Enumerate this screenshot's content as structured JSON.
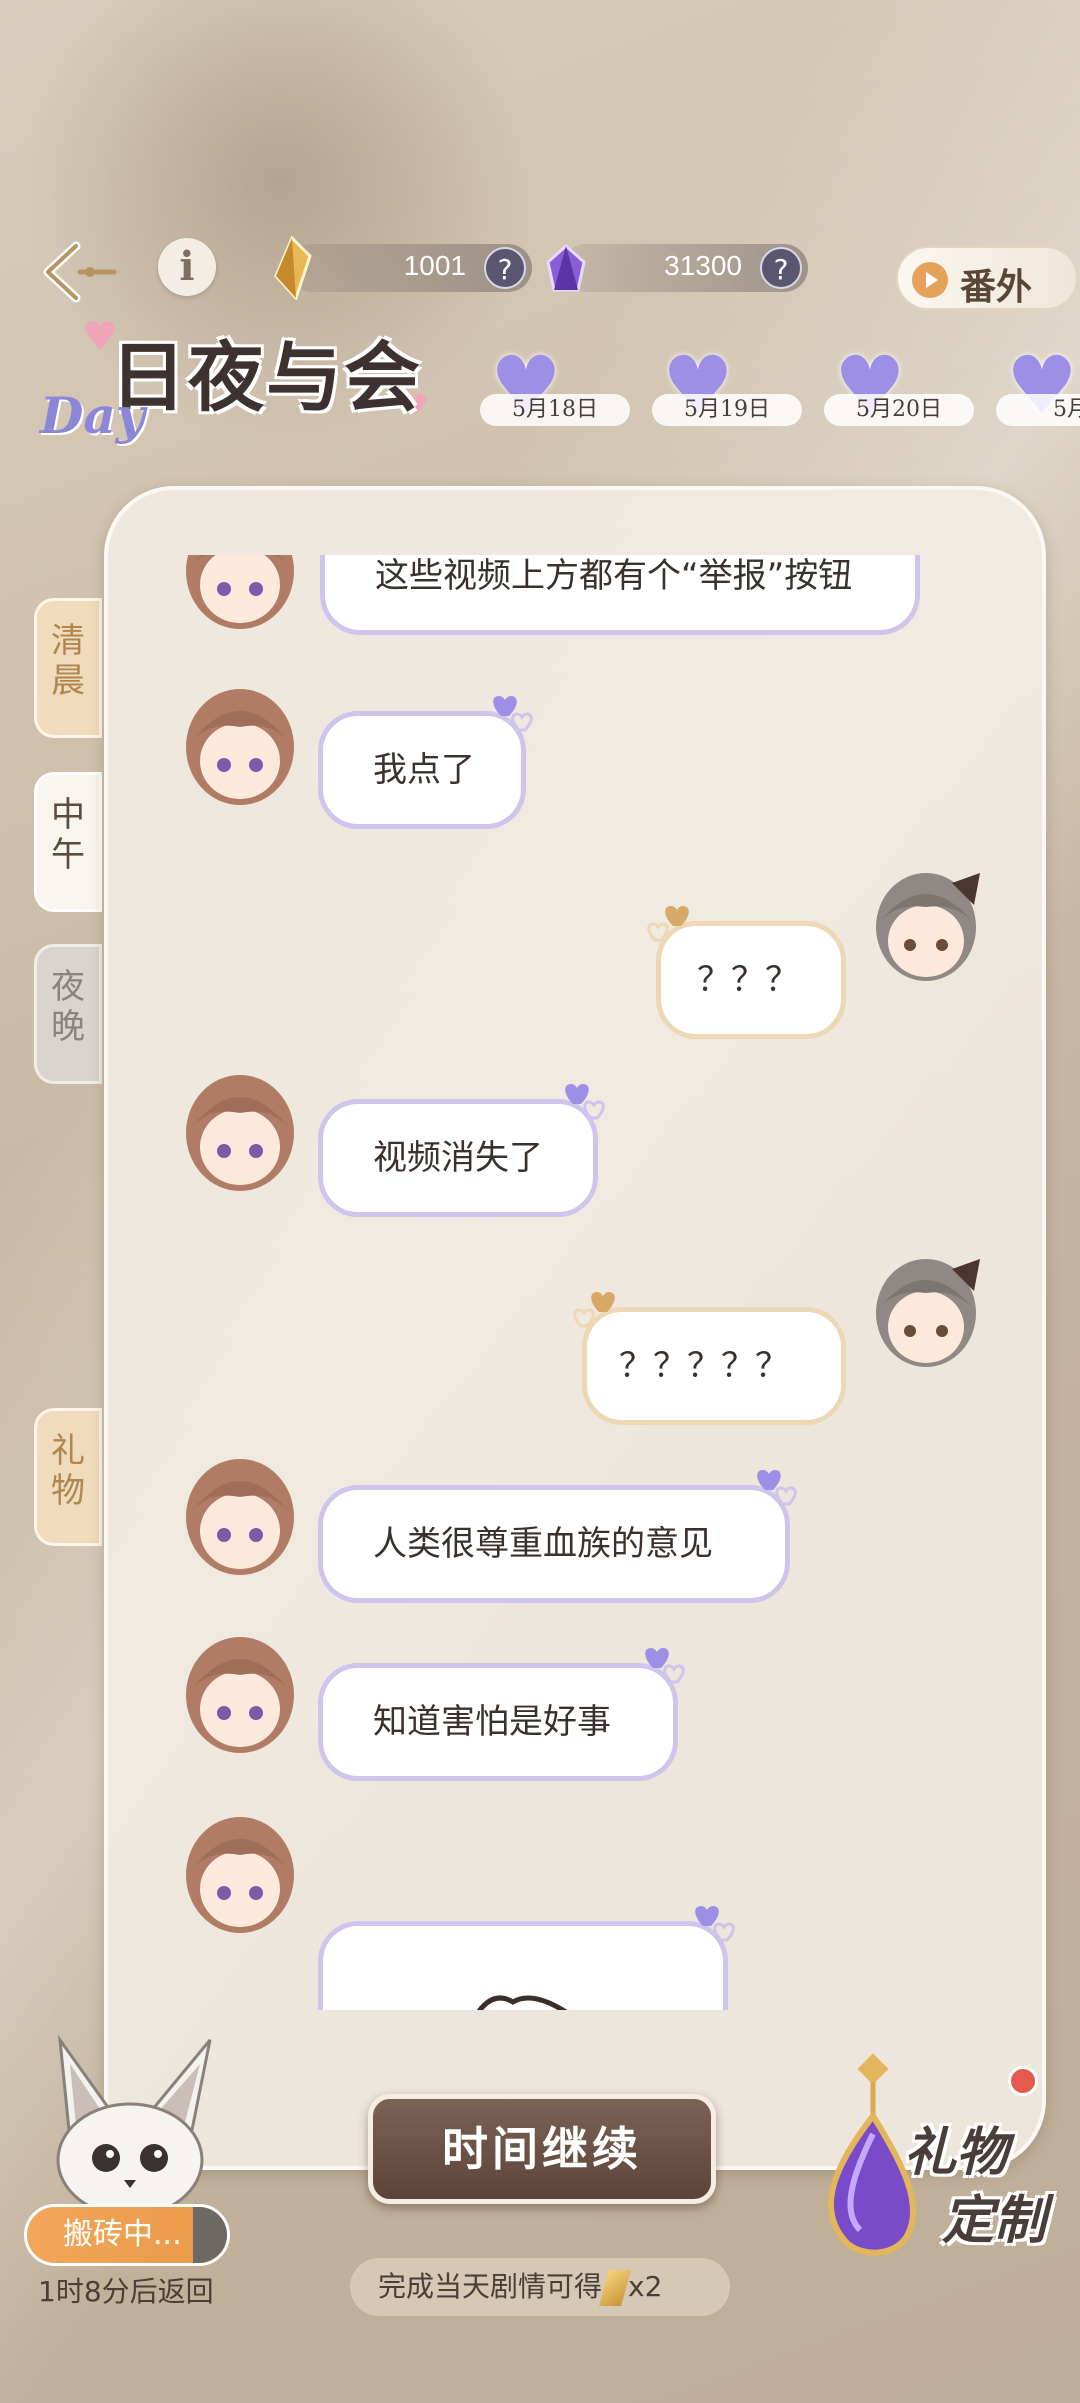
{
  "header": {
    "currency_gold": "1001",
    "currency_purple": "31300",
    "help_symbol": "?",
    "info_symbol": "i",
    "extra_label": "番外"
  },
  "logo": {
    "title": "日夜与会",
    "day": "Day"
  },
  "day_tabs": [
    "5月18日",
    "5月19日",
    "5月20日",
    "5月"
  ],
  "side_tabs": {
    "morning": "清晨",
    "noon": "中午",
    "night": "夜晚",
    "gift": "礼物"
  },
  "messages": [
    {
      "from": "him",
      "text": "这些视频上方都有个“举报”按钮"
    },
    {
      "from": "him",
      "text": "我点了"
    },
    {
      "from": "me",
      "text": "？？？"
    },
    {
      "from": "him",
      "text": "视频消失了"
    },
    {
      "from": "me",
      "text": "？？？？？"
    },
    {
      "from": "him",
      "text": "人类很尊重血族的意见"
    },
    {
      "from": "him",
      "text": "知道害怕是好事"
    },
    {
      "from": "him",
      "text": ""
    }
  ],
  "footer": {
    "continue_label": "时间继续",
    "reward_text": "完成当天剧情可得",
    "reward_count": "x2",
    "work_status": "搬砖中...",
    "return_text": "1时8分后返回",
    "gift_custom_1": "礼物",
    "gift_custom_2": "定制"
  },
  "colors": {
    "accent_purple": "#9d8fe6",
    "accent_gold": "#e4a25a",
    "button_brown": "#6b5246"
  }
}
